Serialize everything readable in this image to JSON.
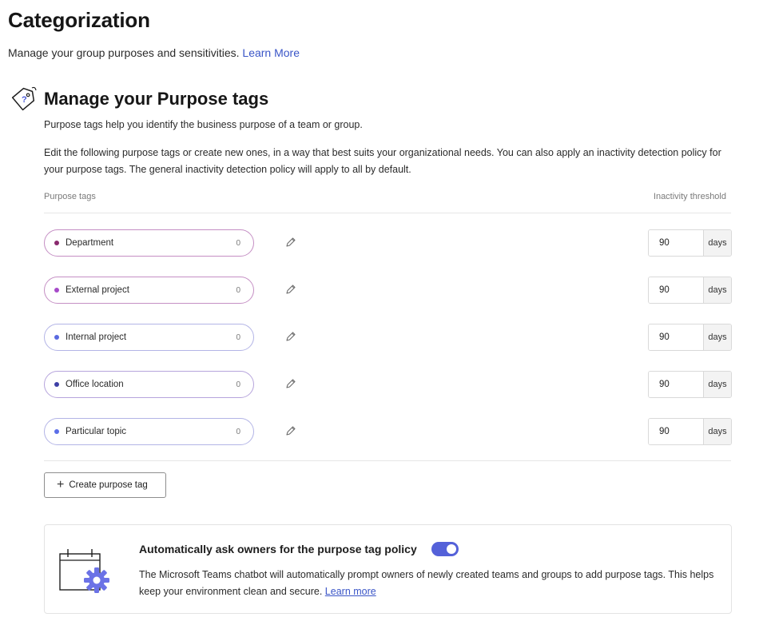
{
  "header": {
    "title": "Categorization",
    "subtitle": "Manage your group purposes and sensitivities.",
    "learn_more": "Learn More"
  },
  "section": {
    "icon": "price-tag-icon",
    "title": "Manage your Purpose tags",
    "description": "Purpose tags help you identify the business purpose of a team or group.",
    "description2": "Edit the following purpose tags or create new ones, in a way that best suits your organizational needs. You can also apply an inactivity detection policy for your purpose tags. The general inactivity detection policy will apply to all by default."
  },
  "table": {
    "col_tags": "Purpose tags",
    "col_threshold": "Inactivity threshold",
    "rows": [
      {
        "label": "Department",
        "count": "0",
        "dot_color": "#8a2a6e",
        "threshold": "90",
        "unit": "days"
      },
      {
        "label": "External project",
        "count": "0",
        "dot_color": "#a64ac9",
        "threshold": "90",
        "unit": "days"
      },
      {
        "label": "Internal project",
        "count": "0",
        "dot_color": "#5a6ae0",
        "threshold": "90",
        "unit": "days"
      },
      {
        "label": "Office location",
        "count": "0",
        "dot_color": "#3d3fa6",
        "threshold": "90",
        "unit": "days"
      },
      {
        "label": "Particular topic",
        "count": "0",
        "dot_color": "#5b6ee8",
        "threshold": "90",
        "unit": "days"
      }
    ]
  },
  "create_button": "Create purpose tag",
  "policy": {
    "title": "Automatically ask owners for the purpose tag policy",
    "toggle_on": true,
    "text": "The Microsoft Teams chatbot will automatically prompt owners of newly created teams and groups to add purpose tags. This helps keep your environment clean and secure.",
    "learn_more": "Learn more"
  },
  "colors": {
    "accent": "#3a55c7",
    "toggle": "#5461d9",
    "pill_border": "#c58fc4"
  }
}
